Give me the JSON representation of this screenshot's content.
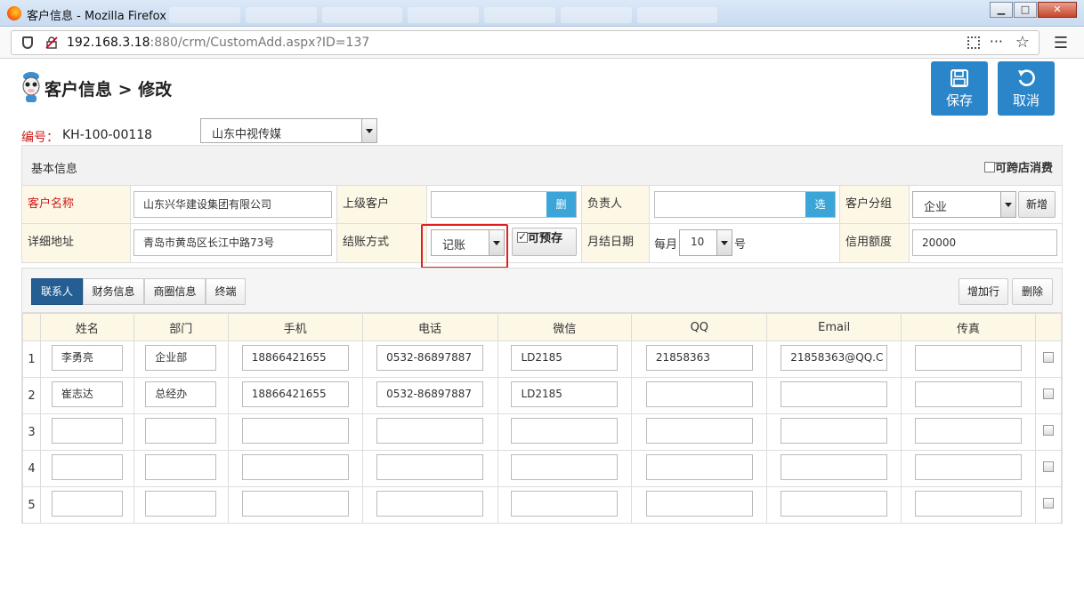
{
  "browser": {
    "window_title": "客户信息 - Mozilla Firefox",
    "url_host": "192.168.3.18",
    "url_rest": ":880/crm/CustomAdd.aspx?ID=137",
    "menu_glyph": "☰",
    "dots_glyph": "···",
    "star_glyph": "☆",
    "min_glyph": "▁",
    "max_glyph": "□",
    "close_glyph": "✕"
  },
  "header": {
    "title": "客户信息 > 修改",
    "save_label": "保存",
    "cancel_label": "取消",
    "code_label": "编号：",
    "code_value": "KH-100-00118",
    "company_selected": "山东中视传媒"
  },
  "basic": {
    "section_title": "基本信息",
    "cross_store_label": "可跨店消费",
    "customer_name_label": "客户名称",
    "customer_name_value": "山东兴华建设集团有限公司",
    "parent_label": "上级客户",
    "parent_value": "",
    "parent_delete_btn": "删",
    "owner_label": "负责人",
    "owner_value": "",
    "owner_select_btn": "选",
    "group_label": "客户分组",
    "group_selected": "企业",
    "group_add_btn": "新增",
    "address_label": "详细地址",
    "address_value": "青岛市黄岛区长江中路73号",
    "settle_label": "结账方式",
    "settle_selected": "记账",
    "prestore_label": "可预存",
    "month_date_label": "月结日期",
    "month_prefix": "每月",
    "month_day_selected": "10",
    "month_suffix": "号",
    "credit_label": "信用额度",
    "credit_value": "20000"
  },
  "contacts": {
    "tabs": [
      "联系人",
      "财务信息",
      "商圈信息",
      "终端"
    ],
    "add_row_btn": "增加行",
    "delete_btn": "删除",
    "columns": [
      "姓名",
      "部门",
      "手机",
      "电话",
      "微信",
      "QQ",
      "Email",
      "传真"
    ],
    "rows": [
      {
        "no": "1",
        "cells": [
          "李勇亮",
          "企业部",
          "18866421655",
          "0532-86897887",
          "LD2185",
          "21858363",
          "21858363@QQ.C",
          ""
        ]
      },
      {
        "no": "2",
        "cells": [
          "崔志达",
          "总经办",
          "18866421655",
          "0532-86897887",
          "LD2185",
          "",
          "",
          ""
        ]
      },
      {
        "no": "3",
        "cells": [
          "",
          "",
          "",
          "",
          "",
          "",
          "",
          ""
        ]
      },
      {
        "no": "4",
        "cells": [
          "",
          "",
          "",
          "",
          "",
          "",
          "",
          ""
        ]
      },
      {
        "no": "5",
        "cells": [
          "",
          "",
          "",
          "",
          "",
          "",
          "",
          ""
        ]
      }
    ]
  },
  "colors": {
    "primary_button": "#2a86c9",
    "active_tab": "#245e93",
    "label_bg": "#fdf7e6",
    "required_text": "#d01a1a",
    "highlight_box": "#e02020"
  }
}
